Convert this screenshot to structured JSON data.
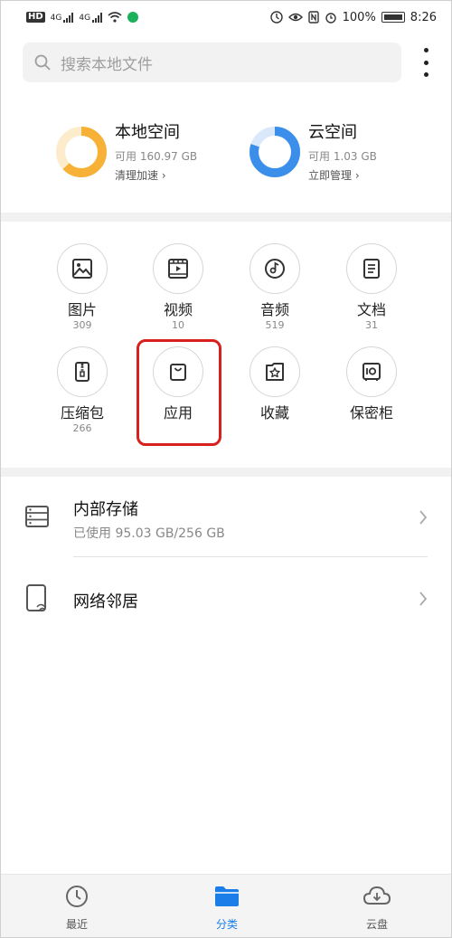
{
  "status_bar": {
    "left_chip": "HD",
    "sig1": "4G",
    "sig2": "4G",
    "battery_text": "100%",
    "time": "8:26"
  },
  "search": {
    "placeholder": "搜索本地文件"
  },
  "storage": {
    "local": {
      "title": "本地空间",
      "available": "可用 160.97 GB",
      "action": "清理加速 ›",
      "fill_fraction": 0.63,
      "color": "#f7b136"
    },
    "cloud": {
      "title": "云空间",
      "available": "可用 1.03 GB",
      "action": "立即管理 ›",
      "fill_fraction": 0.8,
      "color": "#3b8fea"
    }
  },
  "categories": [
    {
      "label": "图片",
      "count": "309",
      "icon": "image-icon"
    },
    {
      "label": "视频",
      "count": "10",
      "icon": "video-icon"
    },
    {
      "label": "音频",
      "count": "519",
      "icon": "audio-icon"
    },
    {
      "label": "文档",
      "count": "31",
      "icon": "document-icon"
    },
    {
      "label": "压缩包",
      "count": "266",
      "icon": "archive-icon"
    },
    {
      "label": "应用",
      "count": "",
      "icon": "app-bag-icon"
    },
    {
      "label": "收藏",
      "count": "",
      "icon": "favorites-icon"
    },
    {
      "label": "保密柜",
      "count": "",
      "icon": "safe-icon"
    }
  ],
  "locations": {
    "internal": {
      "title": "内部存储",
      "sub": "已使用 95.03 GB/256 GB"
    },
    "network": {
      "title": "网络邻居"
    }
  },
  "bottom_nav": {
    "recent": "最近",
    "categories": "分类",
    "cloud": "云盘",
    "active_color": "#1a7de8"
  }
}
